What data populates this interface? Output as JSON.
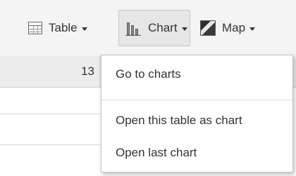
{
  "toolbar": {
    "table_label": "Table",
    "chart_label": "Chart",
    "map_label": "Map",
    "icons": {
      "table": "table-icon",
      "chart": "bar-chart-icon",
      "map": "map-icon",
      "caret": "caret-down-icon"
    }
  },
  "table": {
    "cell_value": "13"
  },
  "chart_menu": {
    "items": [
      {
        "label": "Go to charts"
      },
      {
        "label": "Open this table as chart"
      },
      {
        "label": "Open last chart"
      }
    ]
  }
}
